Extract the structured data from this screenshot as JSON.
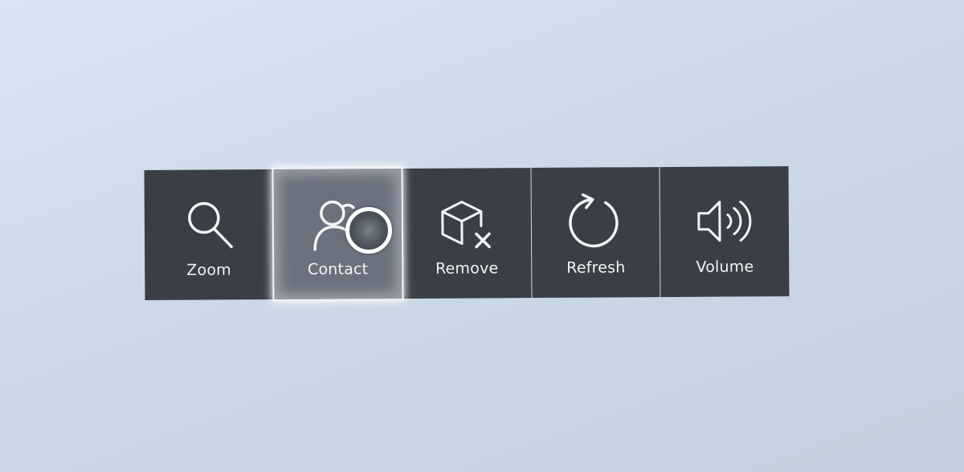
{
  "toolbar": {
    "items": [
      {
        "label": "Zoom",
        "icon": "search-icon",
        "active": false
      },
      {
        "label": "Contact",
        "icon": "contact-icon",
        "active": true
      },
      {
        "label": "Remove",
        "icon": "remove-box-icon",
        "active": false
      },
      {
        "label": "Refresh",
        "icon": "refresh-icon",
        "active": false
      },
      {
        "label": "Volume",
        "icon": "volume-icon",
        "active": false
      }
    ]
  },
  "colors": {
    "tile_background": "#3a3f47",
    "tile_active": "#6c727d",
    "text": "#f3f4f6",
    "page_background": "#d0dceb"
  }
}
